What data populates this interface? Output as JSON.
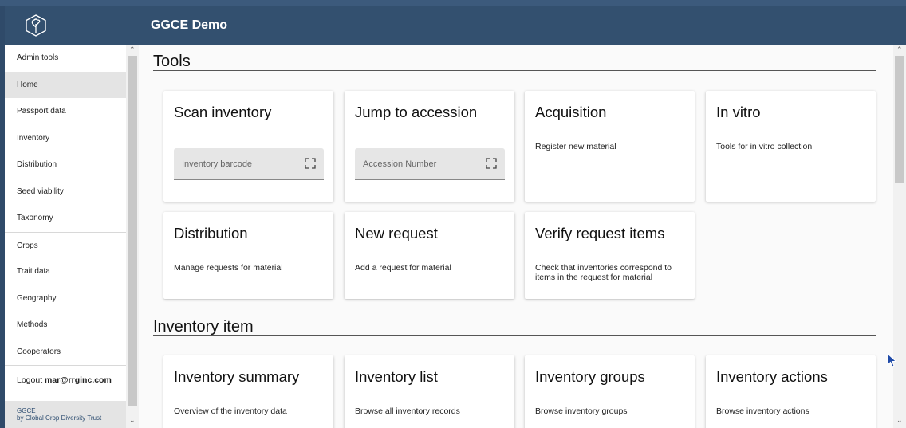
{
  "app": {
    "title": "GGCE Demo"
  },
  "sidebar": {
    "items": [
      {
        "label": "Admin tools"
      },
      {
        "label": "Home"
      },
      {
        "label": "Passport data"
      },
      {
        "label": "Inventory"
      },
      {
        "label": "Distribution"
      },
      {
        "label": "Seed viability"
      },
      {
        "label": "Taxonomy"
      },
      {
        "label": "Crops"
      },
      {
        "label": "Trait data"
      },
      {
        "label": "Geography"
      },
      {
        "label": "Methods"
      },
      {
        "label": "Cooperators"
      }
    ],
    "active": "Home",
    "logout_label": "Logout",
    "logout_user": "mar@rrginc.com",
    "footer_line1": "GGCE",
    "footer_by": "by",
    "footer_brand": "Global Crop Diversity Trust"
  },
  "tools": {
    "title": "Tools",
    "cards": [
      {
        "title": "Scan inventory",
        "placeholder": "Inventory barcode"
      },
      {
        "title": "Jump to accession",
        "placeholder": "Accession Number"
      },
      {
        "title": "Acquisition",
        "desc": "Register new material"
      },
      {
        "title": "In vitro",
        "desc": "Tools for in vitro collection"
      },
      {
        "title": "Distribution",
        "desc": "Manage requests for material"
      },
      {
        "title": "New request",
        "desc": "Add a request for material"
      },
      {
        "title": "Verify request items",
        "desc": "Check that inventories correspond to items in the request for material"
      }
    ]
  },
  "inventory_item": {
    "title": "Inventory item",
    "cards": [
      {
        "title": "Inventory summary",
        "desc": "Overview of the inventory data"
      },
      {
        "title": "Inventory list",
        "desc": "Browse all inventory records"
      },
      {
        "title": "Inventory groups",
        "desc": "Browse inventory groups"
      },
      {
        "title": "Inventory actions",
        "desc": "Browse inventory actions"
      }
    ]
  },
  "icons": {
    "logo": "tree-logo-icon",
    "scan": "scan-frame-icon",
    "scroll_up": "chevron-up-icon",
    "scroll_down": "chevron-down-icon",
    "cursor": "mouse-pointer-icon"
  },
  "colors": {
    "appbar": "#33506f",
    "frame": "#2f4a69",
    "active_nav": "#e4e4e4",
    "brand_link": "#2b4b6f"
  }
}
